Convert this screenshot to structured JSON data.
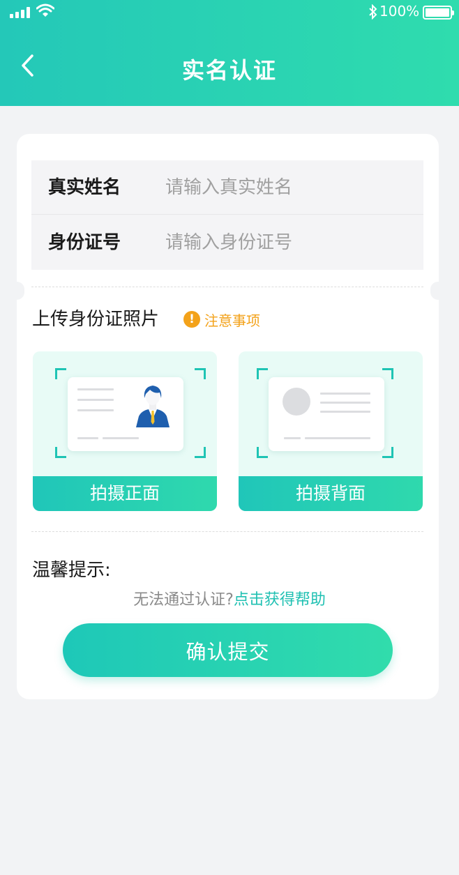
{
  "status_bar": {
    "battery": "100%"
  },
  "header": {
    "title": "实名认证"
  },
  "form": {
    "name_label": "真实姓名",
    "name_placeholder": "请输入真实姓名",
    "id_label": "身份证号",
    "id_placeholder": "请输入身份证号"
  },
  "upload": {
    "title": "上传身份证照片",
    "notice": "注意事项",
    "front_label": "拍摄正面",
    "back_label": "拍摄背面"
  },
  "tips": {
    "title": "温馨提示:",
    "question": "无法通过认证?",
    "help_link": "点击获得帮助"
  },
  "submit_label": "确认提交",
  "colors": {
    "accent": "#27d1b3",
    "warning": "#f3a21a",
    "link": "#1fc0b2",
    "background": "#f2f3f5"
  }
}
